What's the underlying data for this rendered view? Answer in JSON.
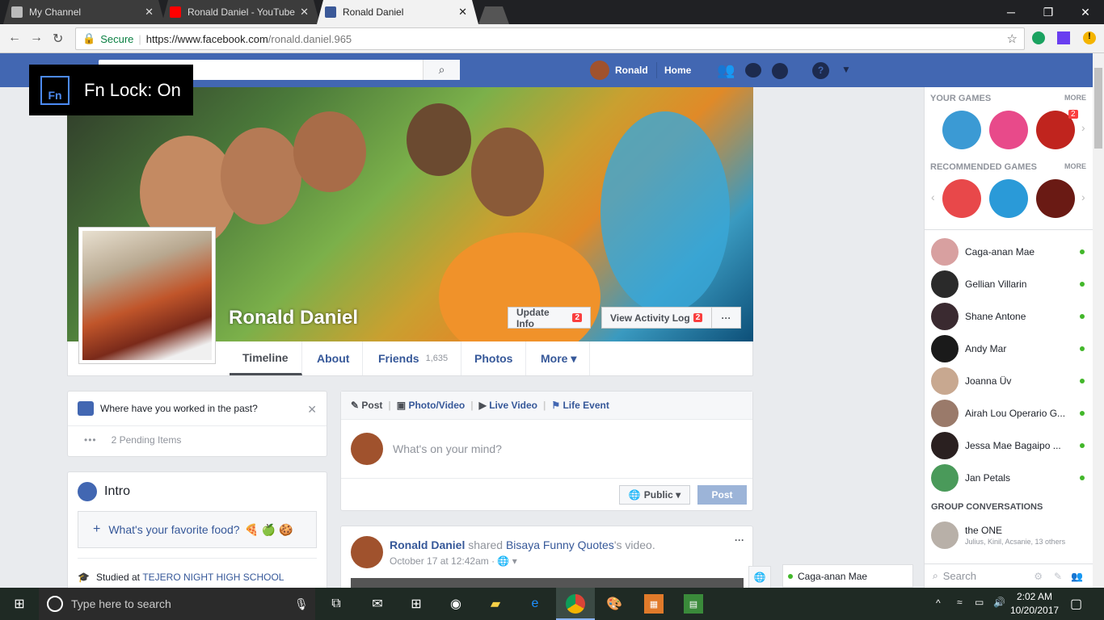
{
  "browser": {
    "tabs": [
      {
        "title": "My Channel"
      },
      {
        "title": "Ronald Daniel - YouTube"
      },
      {
        "title": "Ronald Daniel"
      }
    ],
    "secure_label": "Secure",
    "url_prefix": "https://www.facebook.com",
    "url_path": "/ronald.daniel.965"
  },
  "fb_header": {
    "user_name": "Ronald",
    "home_label": "Home"
  },
  "fn_lock": {
    "icon_text": "Fn",
    "label": "Fn Lock: On"
  },
  "profile": {
    "name": "Ronald Daniel",
    "update_info": "Update Info",
    "update_info_badge": "2",
    "activity_log": "View Activity Log",
    "activity_log_badge": "2",
    "more_dots": "···",
    "tabs": [
      {
        "label": "Timeline"
      },
      {
        "label": "About"
      },
      {
        "label": "Friends",
        "count": "1,635"
      },
      {
        "label": "Photos"
      },
      {
        "label": "More ▾"
      }
    ]
  },
  "work_card": {
    "question": "Where have you worked in the past?",
    "pending": "2 Pending Items"
  },
  "intro": {
    "title": "Intro",
    "favorite_food": "What's your favorite food?",
    "studied_prefix": "Studied at ",
    "school": "TEJERO NIGHT HIGH SCHOOL"
  },
  "composer": {
    "actions": [
      "Post",
      "Photo/Video",
      "Live Video",
      "Life Event"
    ],
    "placeholder": "What's on your mind?",
    "privacy": "Public",
    "post_button": "Post"
  },
  "post": {
    "author": "Ronald Daniel",
    "shared": " shared ",
    "page": "Bisaya Funny Quotes",
    "suffix": "'s video.",
    "time": "October 17 at 12:42am",
    "more": "···"
  },
  "sidebar": {
    "your_games": "YOUR GAMES",
    "recommended_games": "RECOMMENDED GAMES",
    "more": "MORE",
    "game_badge": "2",
    "contacts": [
      {
        "name": "Caga-anan Mae"
      },
      {
        "name": "Gellian Villarin"
      },
      {
        "name": "Shane Antone"
      },
      {
        "name": "Andy Mar"
      },
      {
        "name": "Joanna Üv"
      },
      {
        "name": "Airah Lou Operario G..."
      },
      {
        "name": "Jessa Mae Bagaipo ..."
      },
      {
        "name": "Jan Petals"
      }
    ],
    "group_conversations": "GROUP CONVERSATIONS",
    "group_name": "the ONE",
    "group_members": "Julius, Kinil, Acsanie, 13 others",
    "search_placeholder": "Search"
  },
  "chat_tab": {
    "name": "Caga-anan Mae"
  },
  "taskbar": {
    "search_placeholder": "Type here to search",
    "time": "2:02 AM",
    "date": "10/20/2017"
  },
  "colors": {
    "fb_blue": "#4267b2",
    "link": "#365899",
    "online": "#42b72a",
    "badge": "#fa3e3e"
  }
}
